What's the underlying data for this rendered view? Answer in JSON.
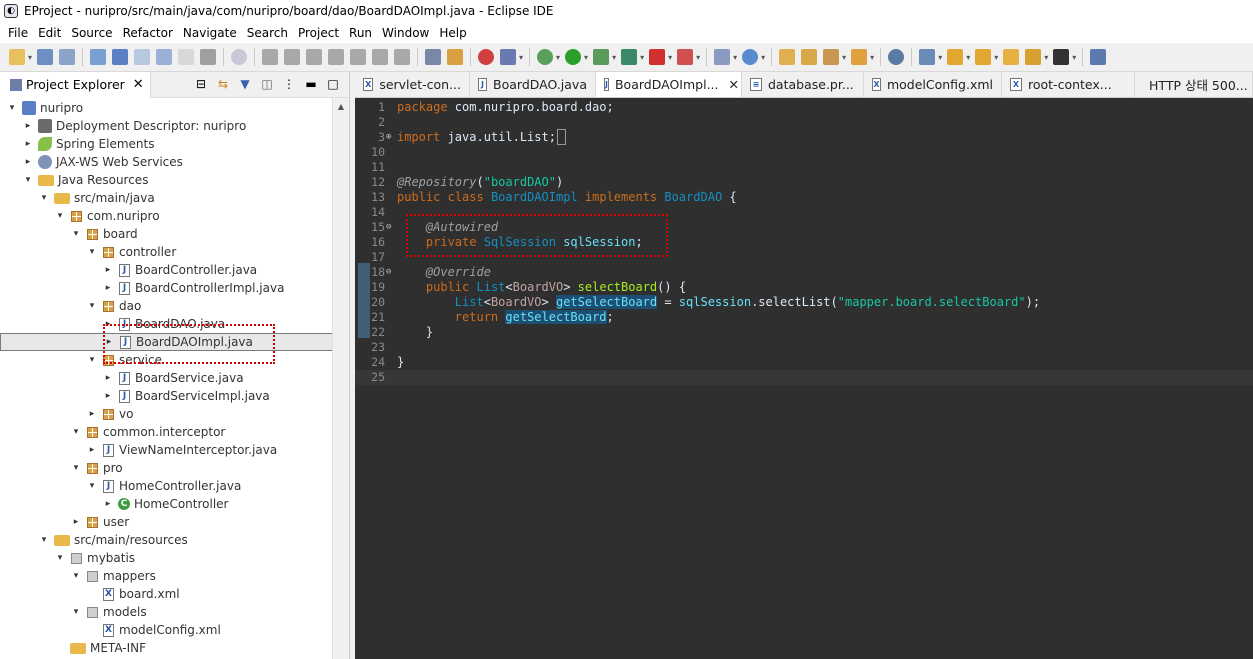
{
  "window": {
    "title": "EProject - nuripro/src/main/java/com/nuripro/board/dao/BoardDAOImpl.java - Eclipse IDE"
  },
  "menu": [
    "File",
    "Edit",
    "Source",
    "Refactor",
    "Navigate",
    "Search",
    "Project",
    "Run",
    "Window",
    "Help"
  ],
  "explorer": {
    "title": "Project Explorer",
    "tree": [
      {
        "label": "nuripro",
        "depth": 0,
        "twisty": "▾",
        "icon": "project-icon"
      },
      {
        "label": "Deployment Descriptor: nuripro",
        "depth": 1,
        "twisty": "▸",
        "icon": "deployment-descriptor-icon"
      },
      {
        "label": "Spring Elements",
        "depth": 1,
        "twisty": "▸",
        "icon": "spring-leaf-icon"
      },
      {
        "label": "JAX-WS Web Services",
        "depth": 1,
        "twisty": "▸",
        "icon": "web-services-icon"
      },
      {
        "label": "Java Resources",
        "depth": 1,
        "twisty": "▾",
        "icon": "java-resources-icon"
      },
      {
        "label": "src/main/java",
        "depth": 2,
        "twisty": "▾",
        "icon": "source-folder-icon"
      },
      {
        "label": "com.nuripro",
        "depth": 3,
        "twisty": "▾",
        "icon": "package-icon"
      },
      {
        "label": "board",
        "depth": 4,
        "twisty": "▾",
        "icon": "package-icon"
      },
      {
        "label": "controller",
        "depth": 5,
        "twisty": "▾",
        "icon": "package-icon"
      },
      {
        "label": "BoardController.java",
        "depth": 6,
        "twisty": "▸",
        "icon": "java-file-icon"
      },
      {
        "label": "BoardControllerImpl.java",
        "depth": 6,
        "twisty": "▸",
        "icon": "java-file-icon"
      },
      {
        "label": "dao",
        "depth": 5,
        "twisty": "▾",
        "icon": "package-icon"
      },
      {
        "label": "BoardDAO.java",
        "depth": 6,
        "twisty": "▸",
        "icon": "java-file-icon"
      },
      {
        "label": "BoardDAOImpl.java",
        "depth": 6,
        "twisty": "▸",
        "icon": "java-file-icon",
        "selected": true
      },
      {
        "label": "service",
        "depth": 5,
        "twisty": "▾",
        "icon": "package-icon"
      },
      {
        "label": "BoardService.java",
        "depth": 6,
        "twisty": "▸",
        "icon": "java-file-icon"
      },
      {
        "label": "BoardServiceImpl.java",
        "depth": 6,
        "twisty": "▸",
        "icon": "java-file-icon"
      },
      {
        "label": "vo",
        "depth": 5,
        "twisty": "▸",
        "icon": "package-icon"
      },
      {
        "label": "common.interceptor",
        "depth": 4,
        "twisty": "▾",
        "icon": "package-icon"
      },
      {
        "label": "ViewNameInterceptor.java",
        "depth": 5,
        "twisty": "▸",
        "icon": "java-file-icon"
      },
      {
        "label": "pro",
        "depth": 4,
        "twisty": "▾",
        "icon": "package-icon"
      },
      {
        "label": "HomeController.java",
        "depth": 5,
        "twisty": "▾",
        "icon": "java-file-icon"
      },
      {
        "label": "HomeController",
        "depth": 6,
        "twisty": "▸",
        "icon": "class-icon"
      },
      {
        "label": "user",
        "depth": 4,
        "twisty": "▸",
        "icon": "package-icon"
      },
      {
        "label": "src/main/resources",
        "depth": 2,
        "twisty": "▾",
        "icon": "source-folder-icon"
      },
      {
        "label": "mybatis",
        "depth": 3,
        "twisty": "▾",
        "icon": "package-gray-icon"
      },
      {
        "label": "mappers",
        "depth": 4,
        "twisty": "▾",
        "icon": "package-gray-icon"
      },
      {
        "label": "board.xml",
        "depth": 5,
        "twisty": "",
        "icon": "xml-file-icon"
      },
      {
        "label": "models",
        "depth": 4,
        "twisty": "▾",
        "icon": "package-gray-icon"
      },
      {
        "label": "modelConfig.xml",
        "depth": 5,
        "twisty": "",
        "icon": "xml-file-icon"
      },
      {
        "label": "META-INF",
        "depth": 3,
        "twisty": "",
        "icon": "folder-icon"
      }
    ]
  },
  "editor": {
    "tabs": [
      {
        "label": "servlet-con...",
        "icon": "xml-file-icon"
      },
      {
        "label": "BoardDAO.java",
        "icon": "java-file-icon"
      },
      {
        "label": "BoardDAOImpl...",
        "icon": "java-file-icon",
        "active": true,
        "close": "✕"
      },
      {
        "label": "database.pr...",
        "icon": "properties-file-icon"
      },
      {
        "label": "modelConfig.xml",
        "icon": "xml-file-icon"
      },
      {
        "label": "root-contex...",
        "icon": "xml-file-icon"
      },
      {
        "label": "HTTP 상태 500...",
        "icon": "globe-icon"
      }
    ],
    "lines": [
      {
        "n": "1",
        "code": "package com.nuripro.board.dao;"
      },
      {
        "n": "2",
        "code": ""
      },
      {
        "n": "3",
        "fold": "⊕",
        "code": "import java.util.List;"
      },
      {
        "n": "10",
        "code": ""
      },
      {
        "n": "11",
        "code": ""
      },
      {
        "n": "12",
        "code": "@Repository(\"boardDAO\")"
      },
      {
        "n": "13",
        "code": "public class BoardDAOImpl implements BoardDAO {"
      },
      {
        "n": "14",
        "code": ""
      },
      {
        "n": "15",
        "fold": "⊖",
        "code": "    @Autowired"
      },
      {
        "n": "16",
        "code": "    private SqlSession sqlSession;"
      },
      {
        "n": "17",
        "code": ""
      },
      {
        "n": "18",
        "fold": "⊖",
        "code": "    @Override"
      },
      {
        "n": "19",
        "code": "    public List<BoardVO> selectBoard() {"
      },
      {
        "n": "20",
        "code": "        List<BoardVO> getSelectBoard = sqlSession.selectList(\"mapper.board.selectBoard\");"
      },
      {
        "n": "21",
        "code": "        return getSelectBoard;"
      },
      {
        "n": "22",
        "code": "    }"
      },
      {
        "n": "23",
        "code": ""
      },
      {
        "n": "24",
        "code": "}"
      },
      {
        "n": "25",
        "code": ""
      }
    ]
  }
}
